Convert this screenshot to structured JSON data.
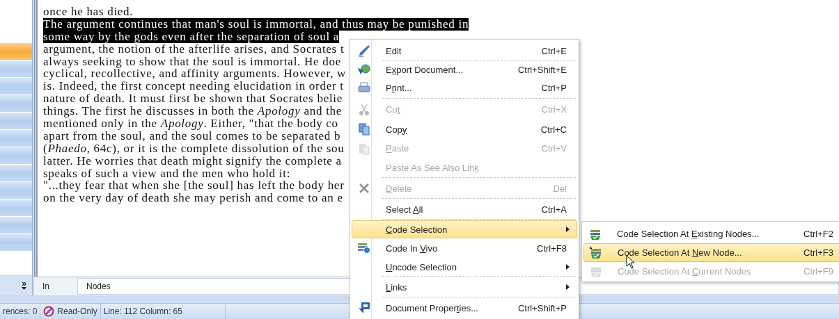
{
  "sidebar": {
    "buttons": [
      {
        "selected": true
      },
      {
        "selected": false
      },
      {
        "selected": false
      },
      {
        "selected": false
      },
      {
        "selected": false
      },
      {
        "selected": false
      },
      {
        "selected": false
      },
      {
        "selected": false
      },
      {
        "selected": false
      },
      {
        "selected": false
      },
      {
        "selected": false
      },
      {
        "selected": false
      }
    ],
    "more": "»"
  },
  "document": {
    "lines": [
      {
        "text": "once he has died.",
        "selected": false
      },
      {
        "text": "The argument continues that man's soul is immortal, and thus may be punished in",
        "selected": true
      },
      {
        "text": "some way by the gods even after the separation of soul a",
        "selected": true
      },
      {
        "text": "argument, the notion of the afterlife arises, and Socrates t",
        "selected": false
      },
      {
        "text": "always seeking to show that the soul is immortal. He doe",
        "selected": false
      },
      {
        "text": "cyclical, recollective, and affinity arguments. However, w",
        "selected": false
      },
      {
        "text": "is. Indeed, the first concept needing elucidation in order t",
        "selected": false
      },
      {
        "text": "nature of death. It must first be shown that Socrates belie",
        "selected": false
      },
      {
        "text": "things. The first he discusses in both the *Apology* and the",
        "selected": false
      },
      {
        "text": "mentioned only in the *Apology*. Either, \"that the body co",
        "selected": false
      },
      {
        "text": "apart from the soul, and the soul comes to be separated b",
        "selected": false
      },
      {
        "text": "(*Phaedo*, 64c), or it is the complete dissolution of the sou",
        "selected": false
      },
      {
        "text": "latter. He worries that death might signify the complete a",
        "selected": false
      },
      {
        "text": "speaks of such a view and the men who hold it:",
        "selected": false
      },
      {
        "text": "\"...they fear that when she [the soul] has left the body her",
        "selected": false
      },
      {
        "text": "on the very day of death she may perish and come to an e",
        "selected": false
      }
    ]
  },
  "in_bar": {
    "label": "In",
    "value": "Nodes"
  },
  "status_bar": {
    "references": "rences: 0",
    "read_only": "Read-Only",
    "position": "Line: 112 Column: 65"
  },
  "context_menu": {
    "items": [
      {
        "label": {
          "before": "Edit"
        },
        "shortcut": "Ctrl+E",
        "disabled": false,
        "selected": false,
        "submenu": false,
        "separator_after": true
      },
      {
        "label": {
          "before": "E",
          "key": "x",
          "after": "port Document..."
        },
        "shortcut": "Ctrl+Shift+E",
        "disabled": false,
        "selected": false,
        "submenu": false,
        "separator_after": false
      },
      {
        "label": {
          "before": "P",
          "key": "r",
          "after": "int..."
        },
        "shortcut": "Ctrl+P",
        "disabled": false,
        "selected": false,
        "submenu": false,
        "separator_after": true
      },
      {
        "label": {
          "before": "Cu",
          "key": "t"
        },
        "shortcut": "Ctrl+X",
        "disabled": true,
        "selected": false,
        "submenu": false,
        "separator_after": false
      },
      {
        "label": {
          "before": "Cop",
          "key": "y"
        },
        "shortcut": "Ctrl+C",
        "disabled": false,
        "selected": false,
        "submenu": false,
        "separator_after": false
      },
      {
        "label": {
          "key": "P",
          "after": "aste"
        },
        "shortcut": "Ctrl+V",
        "disabled": true,
        "selected": false,
        "submenu": false,
        "separator_after": false
      },
      {
        "label": {
          "before": "Paste As See Also Lin",
          "key": "k"
        },
        "disabled": true,
        "selected": false,
        "submenu": false,
        "separator_after": true
      },
      {
        "label": {
          "key": "D",
          "after": "elete"
        },
        "shortcut": "Del",
        "disabled": true,
        "selected": false,
        "submenu": false,
        "separator_after": true
      },
      {
        "label": {
          "before": "Select ",
          "key": "A",
          "after": "ll"
        },
        "shortcut": "Ctrl+A",
        "disabled": false,
        "selected": false,
        "submenu": false,
        "separator_after": true
      },
      {
        "label": {
          "key": "C",
          "after": "ode Selection"
        },
        "disabled": false,
        "selected": true,
        "submenu": true,
        "separator_after": false
      },
      {
        "label": {
          "before": "Code In ",
          "key": "V",
          "after": "ivo"
        },
        "shortcut": "Ctrl+F8",
        "disabled": false,
        "selected": false,
        "submenu": false,
        "separator_after": false
      },
      {
        "label": {
          "key": "U",
          "after": "ncode Selection"
        },
        "disabled": false,
        "selected": false,
        "submenu": true,
        "separator_after": true
      },
      {
        "label": {
          "key": "L",
          "after": "inks"
        },
        "disabled": false,
        "selected": false,
        "submenu": true,
        "separator_after": true
      },
      {
        "label": {
          "before": "Document Proper",
          "key": "t",
          "after": "ies..."
        },
        "shortcut": "Ctrl+Shift+P",
        "disabled": false,
        "selected": false,
        "submenu": false,
        "separator_after": false
      }
    ]
  },
  "submenu": {
    "items": [
      {
        "label": {
          "before": "Code Selection At ",
          "key": "E",
          "after": "xisting Nodes..."
        },
        "shortcut": "Ctrl+F2",
        "disabled": false,
        "selected": false,
        "new": false
      },
      {
        "label": {
          "before": "Code Selection At ",
          "key": "N",
          "after": "ew Node..."
        },
        "shortcut": "Ctrl+F3",
        "disabled": false,
        "selected": true,
        "new": true
      },
      {
        "label": {
          "before": "Code Selection At ",
          "key": "C",
          "after": "urrent Nodes"
        },
        "shortcut": "Ctrl+F9",
        "disabled": true,
        "selected": false,
        "new": false
      }
    ]
  }
}
